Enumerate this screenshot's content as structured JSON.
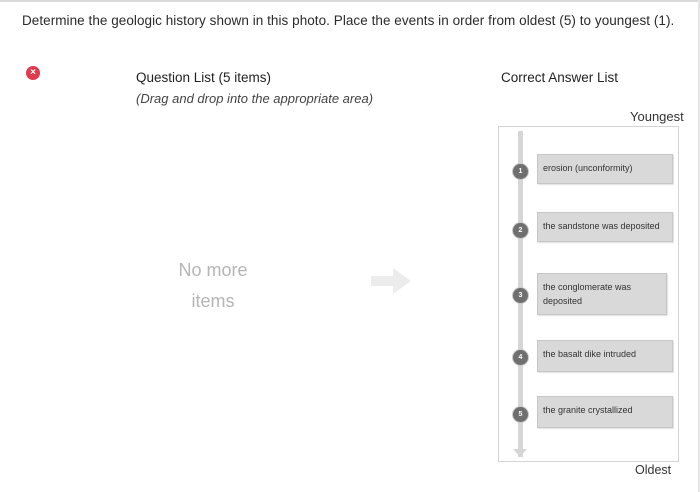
{
  "prompt": "Determine the geologic history shown in this photo. Place the events in order from oldest (5) to youngest (1).",
  "status_icon": "incorrect-icon",
  "question_list": {
    "title": "Question List (5 items)",
    "subtitle": "(Drag and drop into the appropriate area)",
    "empty_line1": "No more",
    "empty_line2": "items"
  },
  "answer_area": {
    "title": "Correct Answer List",
    "top_label": "Youngest",
    "bottom_label": "Oldest",
    "items": [
      {
        "number": "1",
        "text": "erosion (unconformity)"
      },
      {
        "number": "2",
        "text": "the sandstone was deposited"
      },
      {
        "number": "3",
        "text": "the conglomerate was deposited"
      },
      {
        "number": "4",
        "text": "the basalt dike intruded"
      },
      {
        "number": "5",
        "text": "the granite crystallized"
      }
    ]
  },
  "colors": {
    "incorrect": "#e03a4e",
    "card": "#d9d9d9",
    "empty_text": "#b5b5b5"
  }
}
